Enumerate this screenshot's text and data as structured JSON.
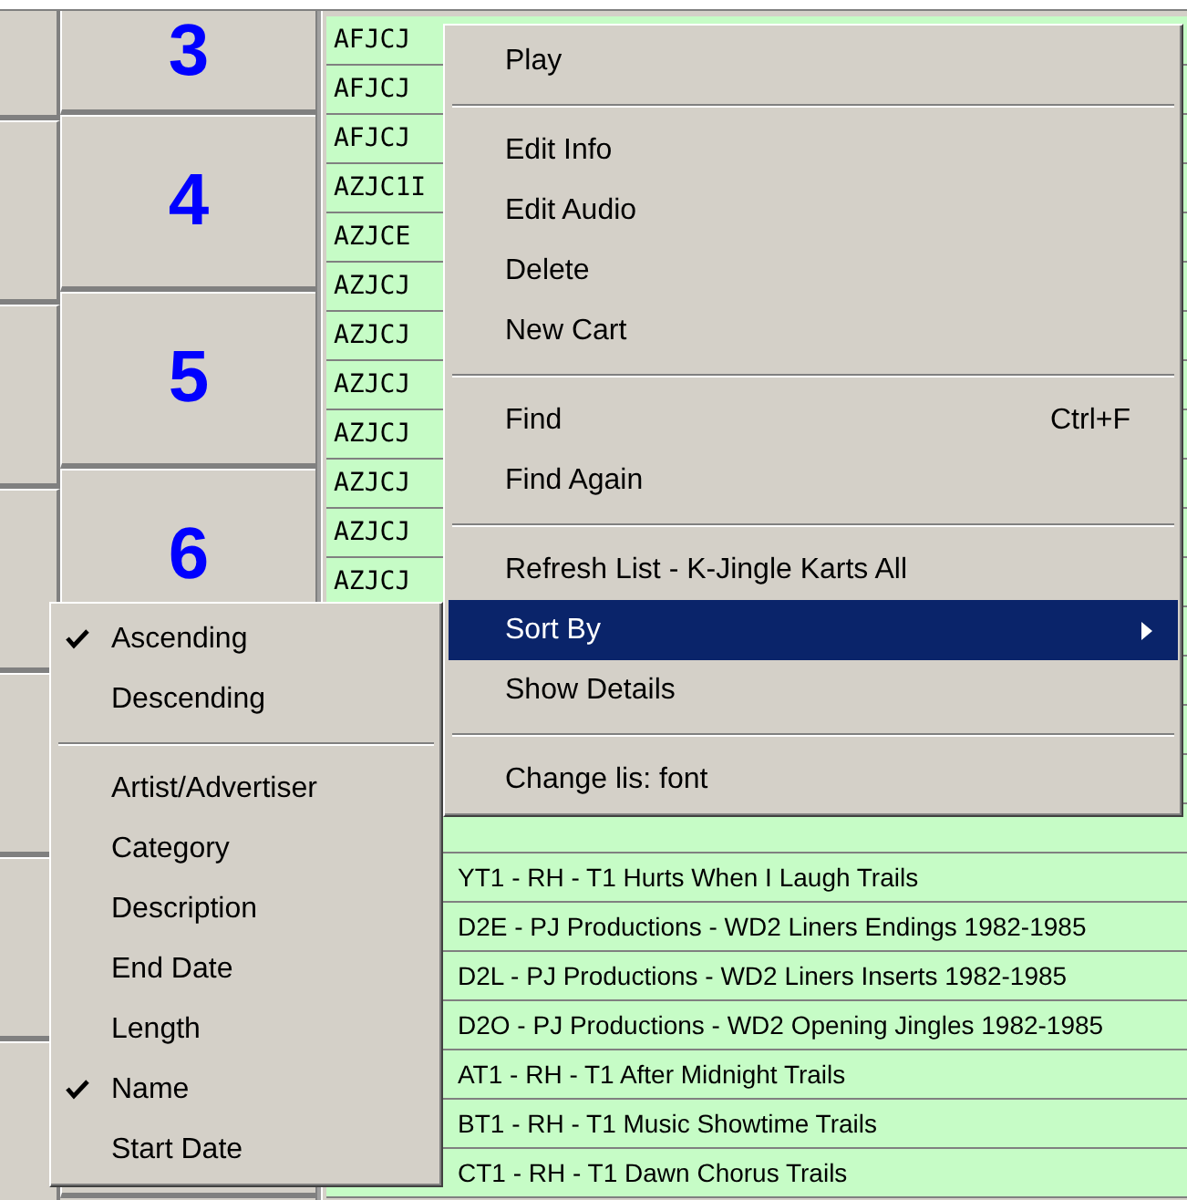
{
  "number_buttons": [
    "3",
    "4",
    "5",
    "6"
  ],
  "list": {
    "rows_top": [
      "AFJCJ",
      "AFJCJ",
      "AFJCJ",
      "AZJC1I",
      "AZJCE",
      "AZJCJ",
      "AZJCJ",
      "AZJCJ",
      "AZJCJ",
      "AZJCJ",
      "AZJCJ",
      "AZJCJ"
    ],
    "rows_bottom": [
      "YT1 - RH - T1 Hurts When I Laugh Trails",
      "D2E - PJ Productions - WD2 Liners Endings 1982-1985",
      "D2L - PJ Productions - WD2 Liners Inserts 1982-1985",
      "D2O - PJ Productions - WD2 Opening Jingles 1982-1985",
      "AT1 - RH - T1 After Midnight Trails",
      "BT1 - RH - T1 Music Showtime Trails",
      "CT1 - RH - T1 Dawn Chorus Trails"
    ]
  },
  "context_menu": {
    "items": [
      {
        "kind": "item",
        "label": "Play",
        "selected": false,
        "has_submenu": false
      },
      {
        "kind": "separator"
      },
      {
        "kind": "item",
        "label": "Edit Info",
        "selected": false,
        "has_submenu": false
      },
      {
        "kind": "item",
        "label": "Edit Audio",
        "selected": false,
        "has_submenu": false
      },
      {
        "kind": "item",
        "label": "Delete",
        "selected": false,
        "has_submenu": false
      },
      {
        "kind": "item",
        "label": "New Cart",
        "selected": false,
        "has_submenu": false
      },
      {
        "kind": "separator"
      },
      {
        "kind": "item",
        "label": "Find",
        "shortcut": "Ctrl+F",
        "selected": false,
        "has_submenu": false
      },
      {
        "kind": "item",
        "label": "Find Again",
        "selected": false,
        "has_submenu": false
      },
      {
        "kind": "separator"
      },
      {
        "kind": "item",
        "label": "Refresh List - K-Jingle Karts All",
        "selected": false,
        "has_submenu": false
      },
      {
        "kind": "item",
        "label": "Sort By",
        "selected": true,
        "has_submenu": true
      },
      {
        "kind": "item",
        "label": "Show Details",
        "selected": false,
        "has_submenu": false
      },
      {
        "kind": "separator"
      },
      {
        "kind": "item",
        "label": "Change lis: font",
        "selected": false,
        "has_submenu": false
      }
    ]
  },
  "sort_submenu": {
    "items": [
      {
        "kind": "item",
        "label": "Ascending",
        "checked": true
      },
      {
        "kind": "item",
        "label": "Descending",
        "checked": false
      },
      {
        "kind": "separator"
      },
      {
        "kind": "item",
        "label": "Artist/Advertiser",
        "checked": false
      },
      {
        "kind": "item",
        "label": "Category",
        "checked": false
      },
      {
        "kind": "item",
        "label": "Description",
        "checked": false
      },
      {
        "kind": "item",
        "label": "End Date",
        "checked": false
      },
      {
        "kind": "item",
        "label": "Length",
        "checked": false
      },
      {
        "kind": "item",
        "label": "Name",
        "checked": true
      },
      {
        "kind": "item",
        "label": "Start Date",
        "checked": false
      }
    ]
  }
}
